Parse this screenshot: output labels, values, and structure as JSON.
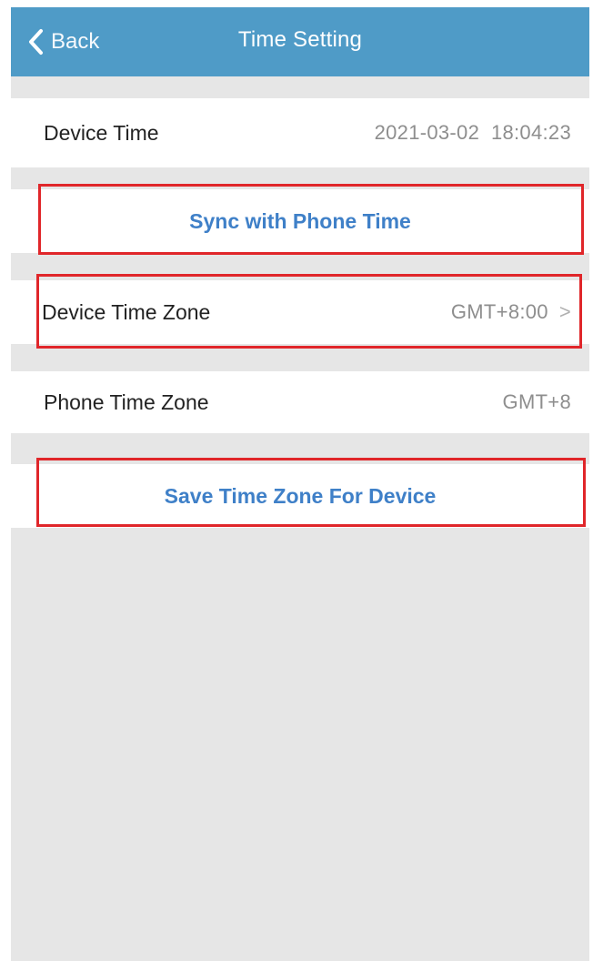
{
  "navbar": {
    "back_label": "Back",
    "title": "Time Setting"
  },
  "device_time": {
    "label": "Device Time",
    "value": "2021-03-02  18:04:23"
  },
  "sync_button": {
    "label": "Sync with Phone Time"
  },
  "device_time_zone": {
    "label": "Device Time Zone",
    "value": "GMT+8:00",
    "chevron": ">"
  },
  "phone_time_zone": {
    "label": "Phone Time Zone",
    "value": "GMT+8"
  },
  "save_button": {
    "label": "Save Time Zone For Device"
  },
  "colors": {
    "navbar": "#4f9bc7",
    "accent_text": "#3f80c8",
    "highlight": "#e0262a",
    "background": "#e6e6e6"
  },
  "icons": {
    "back": "chevron-left-icon",
    "disclosure": "chevron-right-icon"
  }
}
